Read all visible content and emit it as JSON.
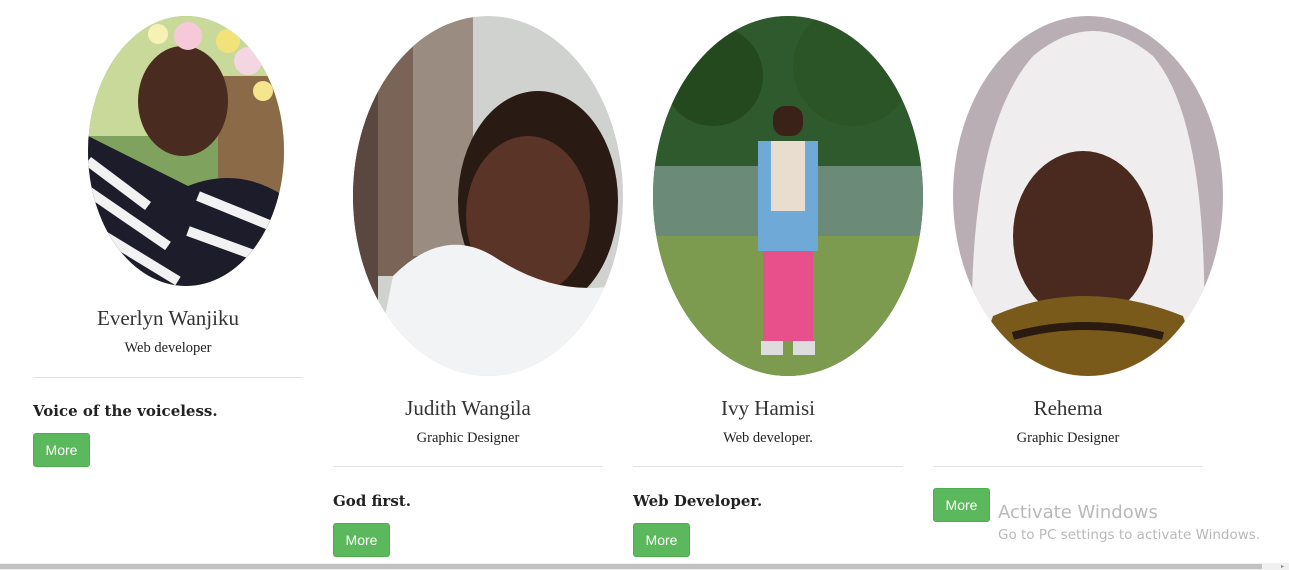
{
  "members": [
    {
      "name": "Everlyn Wanjiku",
      "role": "Web developer",
      "quote": "Voice of the voiceless.",
      "button": "More",
      "photo_icon": "portrait-photo"
    },
    {
      "name": "Judith Wangila",
      "role": "Graphic Designer",
      "quote": "God first.",
      "button": "More",
      "photo_icon": "portrait-photo"
    },
    {
      "name": "Ivy Hamisi",
      "role": "Web developer.",
      "quote": "Web Developer.",
      "button": "More",
      "photo_icon": "portrait-photo"
    },
    {
      "name": "Rehema",
      "role": "Graphic Designer",
      "quote": "",
      "button": "More",
      "photo_icon": "portrait-photo"
    }
  ],
  "watermark": {
    "title": "Activate Windows",
    "subtitle": "Go to PC settings to activate Windows."
  },
  "colors": {
    "button_bg": "#5cb85c",
    "divider": "#e4e4e4",
    "watermark": "#b9b9b9"
  }
}
